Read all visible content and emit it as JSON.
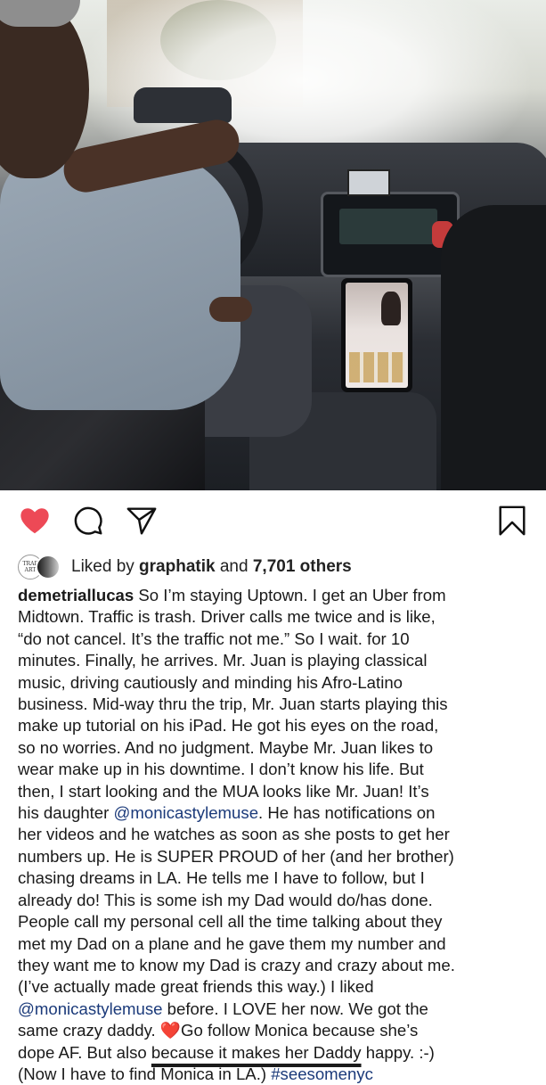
{
  "post": {
    "likes": {
      "prefix": "Liked by ",
      "user": "graphatik",
      "middle": " and ",
      "count": "7,701 others",
      "avatar_text": "TRAP ART"
    },
    "caption": {
      "username": "demetriallucas",
      "lines": [
        " So I’m staying Uptown. I get an Uber from",
        "Midtown. Traffic is trash. Driver calls me twice and is like,",
        "“do not cancel. It’s the traffic not me.” So I wait. for 10",
        "minutes. Finally, he arrives. Mr. Juan is playing classical",
        "music, driving cautiously and minding his Afro-Latino",
        "business. Mid-way thru the trip, Mr. Juan starts playing this",
        "make up tutorial on his iPad. He got his eyes on the road,",
        "so no worries. And no judgment. Maybe Mr. Juan likes to",
        "wear make up in his downtime. I don’t know his life. But",
        "then,  I start looking and the MUA looks like Mr. Juan! It’s"
      ],
      "line11_pre": "his daughter ",
      "mention1": "@monicastylemuse",
      "line11_post": ". He has notifications on",
      "lines_b": [
        "her videos and he watches as soon as she posts to get her",
        "numbers up. He is SUPER PROUD of her (and her brother)",
        "chasing dreams in LA. He tells me I have to follow, but I",
        "already do! This is some ish my Dad would do/has done.",
        "People call my personal cell all the time talking about they",
        "met my Dad on a plane and he gave them my number and",
        "they want me to know my Dad is crazy and crazy about me.",
        "(I’ve actually made great friends this way.) I liked"
      ],
      "mention2": "@monicastylemuse",
      "line20_post": " before. I LOVE her now. We got the",
      "line21_pre": "same crazy daddy. ",
      "heart_emoji": "❤️",
      "line21_post": "Go follow Monica because she’s",
      "line22_pre": "dope AF. But also ",
      "line22_hl": "because it makes her Daddy",
      "line22_post": " happy. :-)",
      "line23_pre": "(Now I have to find ",
      "line23_hl": "Monica in LA.",
      "line23_post": ") ",
      "hashtag": "#seesomenyc"
    }
  },
  "colors": {
    "heart": "#ed4956",
    "link": "#1b3a7a",
    "text": "#1a1a1a"
  },
  "icons": [
    "heart-icon",
    "comment-icon",
    "share-icon",
    "bookmark-icon"
  ]
}
